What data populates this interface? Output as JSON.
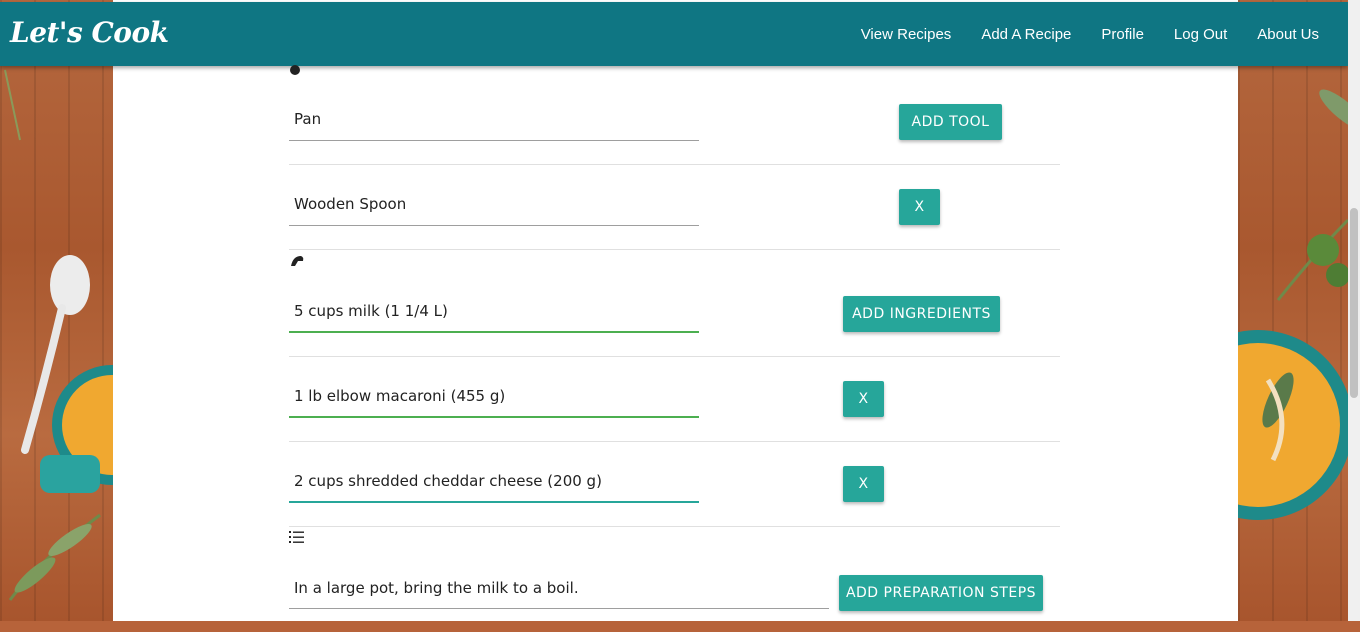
{
  "app": {
    "logo": "Let's Cook"
  },
  "nav": {
    "items": [
      "View Recipes",
      "Add A Recipe",
      "Profile",
      "Log Out",
      "About Us"
    ]
  },
  "tools": {
    "items": [
      {
        "value": "Pan",
        "button": "ADD TOOL"
      },
      {
        "value": "Wooden Spoon",
        "button": "X"
      }
    ]
  },
  "ingredients": {
    "items": [
      {
        "value": "5 cups milk (1 1/4 L)",
        "button": "ADD INGREDIENTS"
      },
      {
        "value": "1 lb elbow macaroni (455 g)",
        "button": "X"
      },
      {
        "value": "2 cups shredded cheddar cheese (200 g)",
        "button": "X"
      }
    ]
  },
  "steps": {
    "items": [
      {
        "value": "In a large pot, bring the milk to a boil.",
        "button": "ADD PREPARATION STEPS"
      }
    ]
  },
  "colors": {
    "navbar": "#0f7683",
    "button": "#26a69a",
    "focus_line": "#4caf50"
  }
}
